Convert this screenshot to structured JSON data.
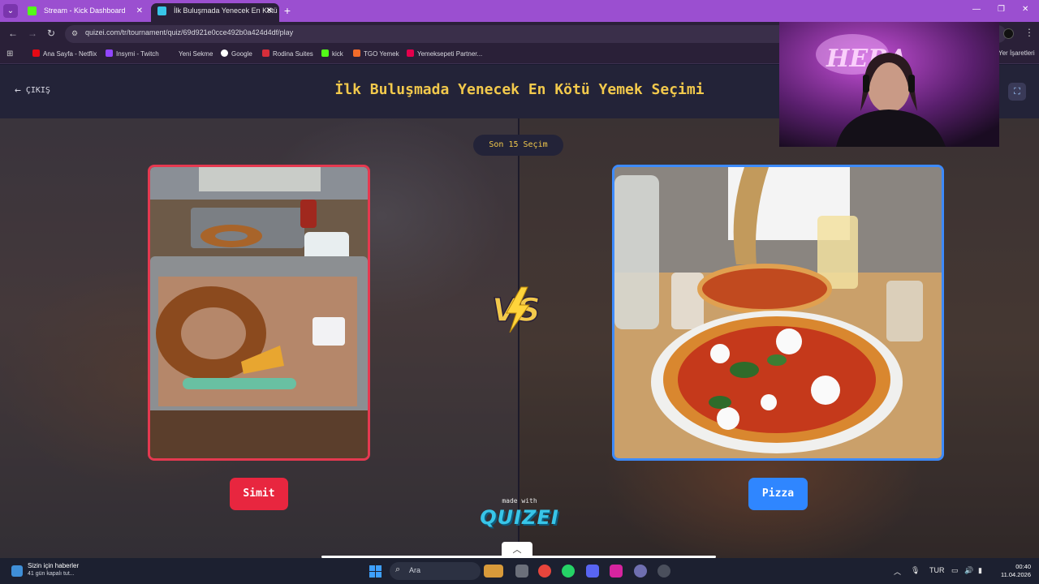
{
  "browser": {
    "tabs": [
      {
        "title": "Stream - Kick Dashboard",
        "favicon": "kick-icon",
        "color": "#53fc18"
      },
      {
        "title": "İlk Buluşmada Yenecek En Kötü",
        "favicon": "quizei-icon",
        "color": "#38c5e8"
      }
    ],
    "url": "quizei.com/tr/tournament/quiz/69d921e0cce492b0a424d4df/play",
    "bookmarks": [
      {
        "label": "Ana Sayfa - Netflix",
        "color": "#e50914"
      },
      {
        "label": "Insymi - Twitch",
        "color": "#9146ff"
      },
      {
        "label": "Yeni Sekme",
        "color": "#2a2038"
      },
      {
        "label": "Google",
        "color": "#4285f4"
      },
      {
        "label": "Rodina Suites",
        "color": "#d62e3a"
      },
      {
        "label": "kick",
        "color": "#53fc18"
      },
      {
        "label": "TGO Yemek",
        "color": "#f26b2a"
      },
      {
        "label": "Yemeksepeti Partner...",
        "color": "#e5004c"
      }
    ],
    "bookmarks_right": "Yer İşaretleri"
  },
  "page": {
    "exit_label": "ÇIKIŞ",
    "title": "İlk Buluşmada Yenecek En Kötü Yemek Seçimi",
    "round_label": "Son 15 Seçim",
    "left_choice": "Simit",
    "right_choice": "Pizza",
    "made_with": "made with",
    "brand": "QUIZEI",
    "accent_left": "#e8263f",
    "accent_right": "#2f86ff",
    "title_color": "#f2c94c"
  },
  "taskbar": {
    "news_title": "Sizin için haberler",
    "news_sub": "41 gün kapalı tut...",
    "search_placeholder": "Ara",
    "language": "TUR",
    "time": "00:40",
    "date": "11.04.2026"
  }
}
